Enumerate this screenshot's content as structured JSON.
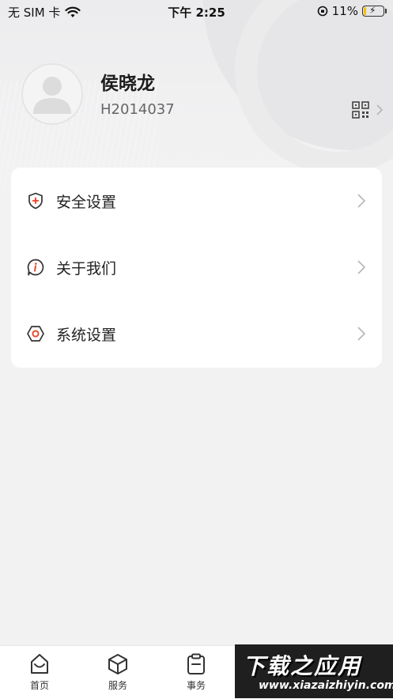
{
  "status_bar": {
    "carrier": "无 SIM 卡",
    "time": "下午 2:25",
    "battery": "11%",
    "battery_level": 0.11
  },
  "profile": {
    "name": "侯晓龙",
    "user_id": "H2014037"
  },
  "menu": {
    "items": [
      {
        "label": "安全设置",
        "icon": "shield-plus-icon"
      },
      {
        "label": "关于我们",
        "icon": "info-bubble-icon"
      },
      {
        "label": "系统设置",
        "icon": "hexagon-settings-icon"
      }
    ]
  },
  "tab_bar": {
    "tabs": [
      {
        "label": "首页",
        "icon": "home-icon"
      },
      {
        "label": "服务",
        "icon": "cube-icon"
      },
      {
        "label": "事务",
        "icon": "clipboard-icon"
      }
    ]
  },
  "watermark": {
    "main": "下载之应用",
    "sub": "www.xiazaizhiyin.com"
  },
  "colors": {
    "accent": "#e8452c",
    "background": "#f2f2f3",
    "card": "#ffffff"
  }
}
